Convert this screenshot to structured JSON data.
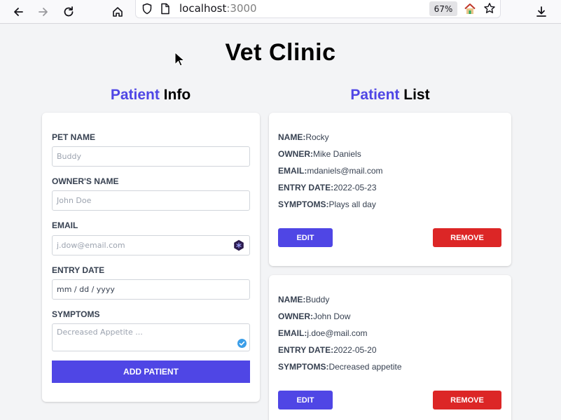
{
  "browser": {
    "url_host": "localhost",
    "url_port": ":3000",
    "zoom": "67%"
  },
  "page": {
    "title": "Vet Clinic",
    "form_title_accent": "Patient",
    "form_title_rest": " Info",
    "list_title_accent": "Patient",
    "list_title_rest": " List"
  },
  "form": {
    "pet_label": "PET NAME",
    "pet_placeholder": "Buddy",
    "owner_label": "OWNER'S NAME",
    "owner_placeholder": "John Doe",
    "email_label": "EMAIL",
    "email_placeholder": "j.dow@email.com",
    "date_label": "ENTRY DATE",
    "date_value": "mm / dd / yyyy",
    "symptoms_label": "SYMPTOMS",
    "symptoms_placeholder": "Decreased Appetite ...",
    "submit_label": "ADD PATIENT"
  },
  "patients": [
    {
      "name_key": "NAME:",
      "name": "Rocky",
      "owner_key": "OWNER:",
      "owner": "Mike Daniels",
      "email_key": "EMAIL:",
      "email": "mdaniels@mail.com",
      "date_key": "ENTRY DATE:",
      "date": "2022-05-23",
      "symptoms_key": "SYMPTOMS:",
      "symptoms": "Plays all day",
      "edit_label": "EDIT",
      "remove_label": "REMOVE"
    },
    {
      "name_key": "NAME:",
      "name": "Buddy",
      "owner_key": "OWNER:",
      "owner": "John Dow",
      "email_key": "EMAIL:",
      "email": "j.doe@mail.com",
      "date_key": "ENTRY DATE:",
      "date": "2022-05-20",
      "symptoms_key": "SYMPTOMS:",
      "symptoms": "Decreased appetite",
      "edit_label": "EDIT",
      "remove_label": "REMOVE"
    }
  ],
  "colors": {
    "accent": "#4f46e5",
    "danger": "#dc2626",
    "page_bg": "#f3f4f6"
  }
}
